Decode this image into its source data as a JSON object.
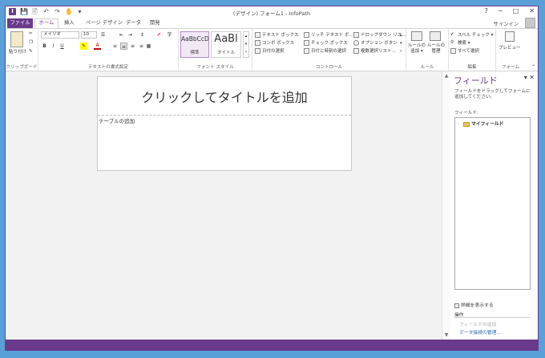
{
  "window": {
    "title": "(デザイン) フォーム1 - InfoPath",
    "help": "?",
    "minimize": "─",
    "restore": "□",
    "close": "✕"
  },
  "qat": {
    "app": "I",
    "save": "💾",
    "preview_icon": "🖹",
    "undo": "↶",
    "redo": "↷",
    "touch": "✋",
    "more": "▾"
  },
  "tabs": {
    "file": "ファイル",
    "home": "ホーム",
    "insert": "挿入",
    "page_design": "ページ デザイン",
    "data": "データ",
    "developer": "開発"
  },
  "account": {
    "signin": "サインイン"
  },
  "ribbon": {
    "clipboard": {
      "paste": "貼り付け",
      "group": "クリップボード"
    },
    "text": {
      "font": "メイリオ",
      "size": "10",
      "bold": "B",
      "italic": "I",
      "underline": "U",
      "group": "テキストの書式設定"
    },
    "styles": {
      "normal_preview": "AaBbCcD",
      "normal": "標準",
      "title_preview": "AaBl",
      "title": "タイトル",
      "group": "フォント スタイル"
    },
    "controls": {
      "items": [
        "テキスト ボックス",
        "リッチ テキスト ボ…",
        "ドロップダウン リス…",
        "コンボ ボックス",
        "チェック ボックス",
        "オプション ボタン",
        "日付の選択",
        "日付と時刻の選択",
        "複数選択リスト…"
      ],
      "group": "コントロール"
    },
    "rules": {
      "add_rule": "ルールの\n追加 ▾",
      "manage_rules": "ルールの\n管理",
      "group": "ルール"
    },
    "editing": {
      "spell": "スペル チェック ▾",
      "find": "検索 ▾",
      "select_all": "すべて選択",
      "group": "編集"
    },
    "form": {
      "preview": "プレビュー",
      "group": "フォーム"
    }
  },
  "form": {
    "title_placeholder": "クリックしてタイトルを追加",
    "table_placeholder": "テーブルの追加"
  },
  "fields_pane": {
    "title": "フィールド",
    "description": "フィールドをドラッグしてフォームに追加してください。",
    "fields_label": "フィールド:",
    "root": "マイフィールド",
    "show_details": "詳細を表示する",
    "actions": "操作",
    "add_field": "フィールドの追加",
    "manage_connections": "データ接続の管理..."
  }
}
